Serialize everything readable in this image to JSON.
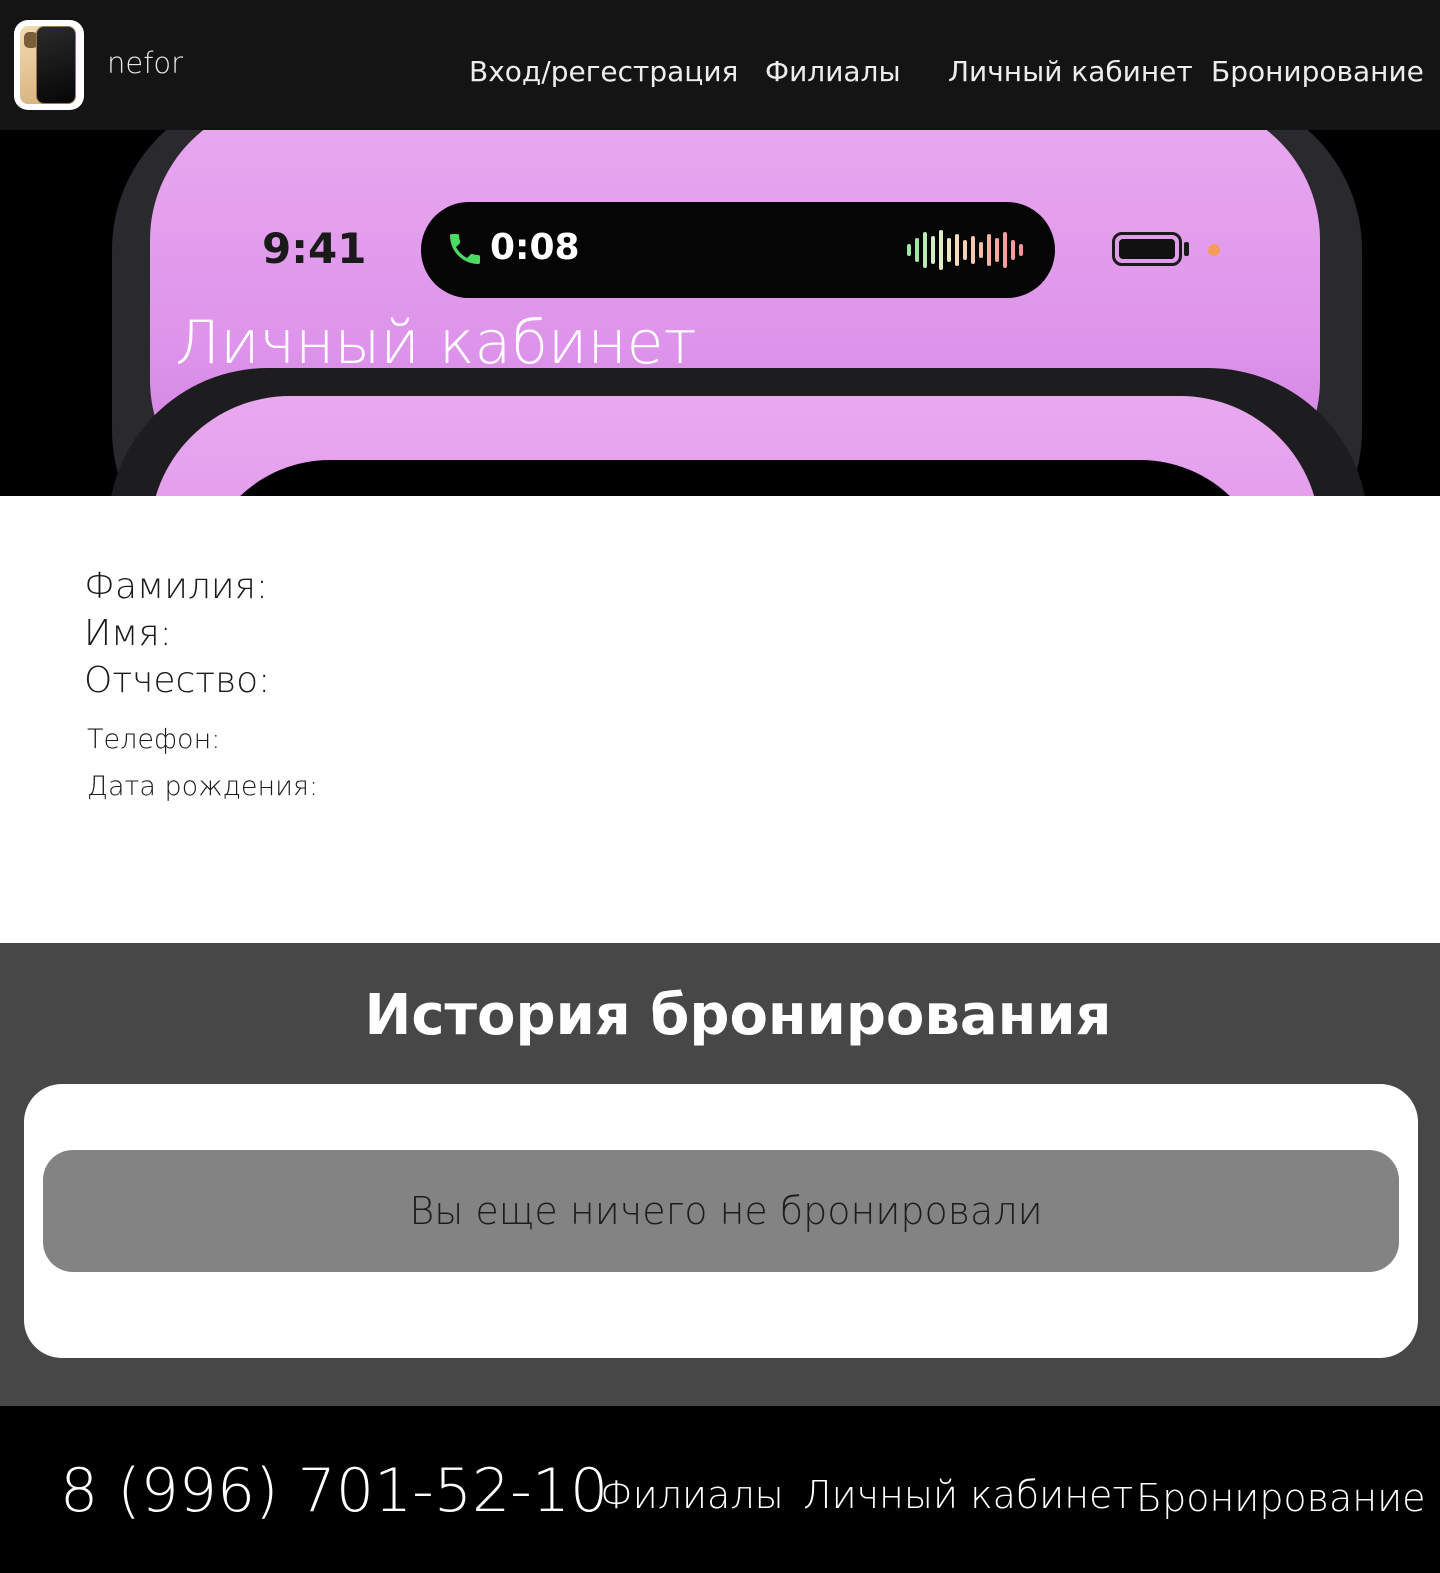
{
  "header": {
    "brand": "nefor",
    "nav": [
      {
        "label": "Вход/регестрация"
      },
      {
        "label": "Филиалы"
      },
      {
        "label": "Личный кабинет"
      },
      {
        "label": "Бронирование"
      }
    ]
  },
  "hero": {
    "title": "Личный кабинет",
    "status_time": "9:41",
    "call_timer": "0:08"
  },
  "profile": {
    "surname_label": "Фамилия:",
    "name_label": "Имя:",
    "patronymic_label": "Отчество:",
    "phone_label": "Телефон:",
    "birthdate_label": "Дата рождения:"
  },
  "history": {
    "title": "История бронирования",
    "empty_message": "Вы еще ничего не бронировали"
  },
  "footer": {
    "phone": "8 (996) 701-52-10",
    "links": [
      {
        "label": "Филиалы"
      },
      {
        "label": "Личный кабинет"
      },
      {
        "label": "Бронирование"
      }
    ]
  },
  "colors": {
    "header_bg": "#141414",
    "history_bg": "#474747",
    "empty_pill": "#838383",
    "footer_bg": "#000000",
    "screen_pink": "#e9a9ef"
  }
}
